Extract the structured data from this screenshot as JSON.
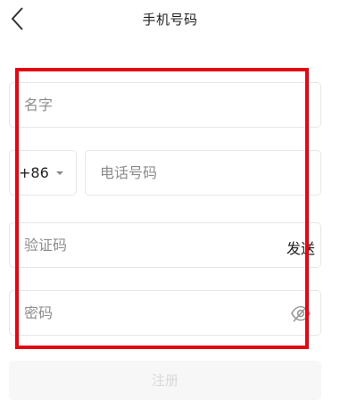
{
  "header": {
    "title": "手机号码",
    "back_icon": "chevron-left-icon"
  },
  "form": {
    "name": {
      "placeholder": "名字",
      "value": ""
    },
    "country_code": {
      "value": "+86",
      "dropdown_icon": "caret-down-icon"
    },
    "phone": {
      "placeholder": "电话号码",
      "value": ""
    },
    "verification_code": {
      "placeholder": "验证码",
      "value": "",
      "send_label": "发送"
    },
    "password": {
      "placeholder": "密码",
      "value": "",
      "visibility_icon": "eye-off-icon"
    },
    "register_label": "注册"
  },
  "colors": {
    "highlight_box": "#e30613",
    "field_border": "#e6e6e6",
    "placeholder_text": "#8c8c8c",
    "register_button_bg": "#f7f7f7",
    "register_button_text": "#d8d8d8"
  }
}
